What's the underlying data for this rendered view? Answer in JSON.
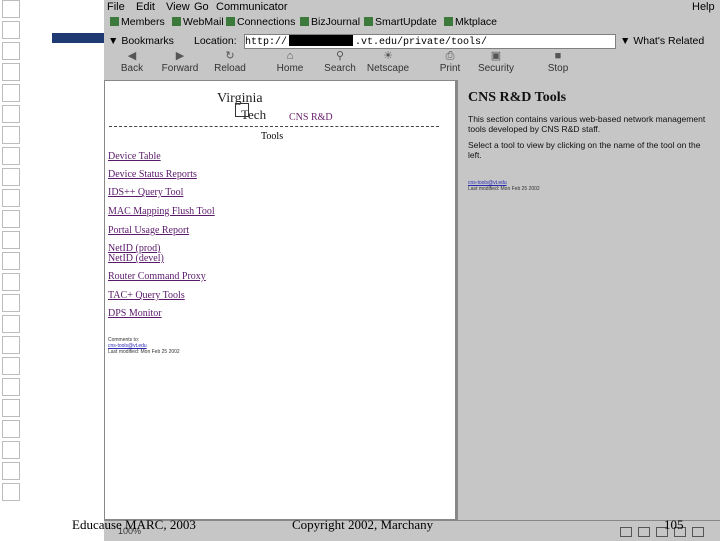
{
  "slide": {
    "footer_left": "Educause MARC, 2003",
    "footer_center": "Copyright 2002, Marchany",
    "page_number": "105"
  },
  "browser": {
    "menu": [
      "File",
      "Edit",
      "View",
      "Go",
      "Communicator"
    ],
    "help": "Help",
    "personal_toolbar": [
      "Members",
      "WebMail",
      "Connections",
      "BizJournal",
      "SmartUpdate",
      "Mktplace"
    ],
    "bookmarks_label": "Bookmarks",
    "location_label": "Location:",
    "url_prefix": "http://",
    "url_suffix": ".vt.edu/private/tools/",
    "whats_related": "What's Related",
    "nav_buttons": [
      {
        "label": "Back",
        "icon": "back-arrow-icon"
      },
      {
        "label": "Forward",
        "icon": "forward-arrow-icon"
      },
      {
        "label": "Reload",
        "icon": "reload-icon"
      },
      {
        "label": "Home",
        "icon": "home-icon"
      },
      {
        "label": "Search",
        "icon": "search-icon"
      },
      {
        "label": "Netscape",
        "icon": "netscape-icon"
      },
      {
        "label": "Print",
        "icon": "print-icon"
      },
      {
        "label": "Security",
        "icon": "lock-icon"
      },
      {
        "label": "Stop",
        "icon": "stop-icon"
      }
    ],
    "status_zoom": "100%"
  },
  "left_frame": {
    "logo_line1": "Virginia",
    "logo_line2": "Tech",
    "subtitle": "CNS R&D",
    "heading": "Tools",
    "links": [
      "Device Table",
      "Device Status Reports",
      "IDS++ Query Tool",
      "MAC Mapping Flush Tool",
      "Portal Usage Report",
      "NetID (prod)",
      "NetID (devel)",
      "Router Command Proxy",
      "TAC+ Query Tools",
      "DPS Monitor"
    ],
    "tiny_comments": "Comments to:",
    "tiny_link": "cns-tools@vt.edu",
    "tiny_line2": "Last modified: Mon Feb 25 2002"
  },
  "right_frame": {
    "title": "CNS R&D Tools",
    "para1": "This section contains various web-based network management tools developed by CNS R&D staff.",
    "para2": "Select a tool to view by clicking on the name of the tool on the left.",
    "tiny_link": "cns-tools@vt.edu",
    "tiny_line": "Last modified: Mon Feb 25 2002"
  }
}
